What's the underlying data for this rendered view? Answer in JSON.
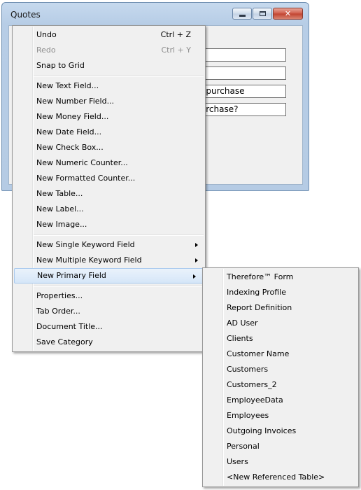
{
  "window": {
    "title": "Quotes",
    "fields": [
      {
        "value": ""
      },
      {
        "value": ""
      },
      {
        "value": "of purchase"
      },
      {
        "value": "purchase?"
      }
    ]
  },
  "context_menu": {
    "items": [
      {
        "label": "Undo",
        "shortcut": "Ctrl + Z",
        "enabled": true
      },
      {
        "label": "Redo",
        "shortcut": "Ctrl + Y",
        "enabled": false
      },
      {
        "label": "Snap to Grid",
        "enabled": true
      },
      {
        "label": "New Text Field...",
        "enabled": true
      },
      {
        "label": "New Number Field...",
        "enabled": true
      },
      {
        "label": "New Money Field...",
        "enabled": true
      },
      {
        "label": "New Date Field...",
        "enabled": true
      },
      {
        "label": "New Check Box...",
        "enabled": true
      },
      {
        "label": "New Numeric Counter...",
        "enabled": true
      },
      {
        "label": "New Formatted Counter...",
        "enabled": true
      },
      {
        "label": "New Table...",
        "enabled": true
      },
      {
        "label": "New Label...",
        "enabled": true
      },
      {
        "label": "New Image...",
        "enabled": true
      },
      {
        "label": "New Single Keyword Field",
        "submenu": true
      },
      {
        "label": "New Multiple Keyword Field",
        "submenu": true
      },
      {
        "label": "New Primary Field",
        "submenu": true,
        "highlighted": true
      },
      {
        "label": "Properties...",
        "enabled": true
      },
      {
        "label": "Tab Order...",
        "enabled": true
      },
      {
        "label": "Document Title...",
        "enabled": true
      },
      {
        "label": "Save Category",
        "enabled": true
      }
    ]
  },
  "submenu": {
    "items": [
      "Therefore™ Form",
      "Indexing Profile",
      "Report Definition",
      "AD User",
      "Clients",
      "Customer Name",
      "Customers",
      "Customers_2",
      "EmployeeData",
      "Employees",
      "Outgoing Invoices",
      "Personal",
      "Users",
      "<New Referenced Table>"
    ]
  },
  "colors": {
    "window_frame": "#b5cbe4",
    "close_button": "#c0422f",
    "menu_background": "#f0f0f0",
    "highlight_border": "#a8c9ee",
    "disabled_text": "#8d8d8d"
  }
}
